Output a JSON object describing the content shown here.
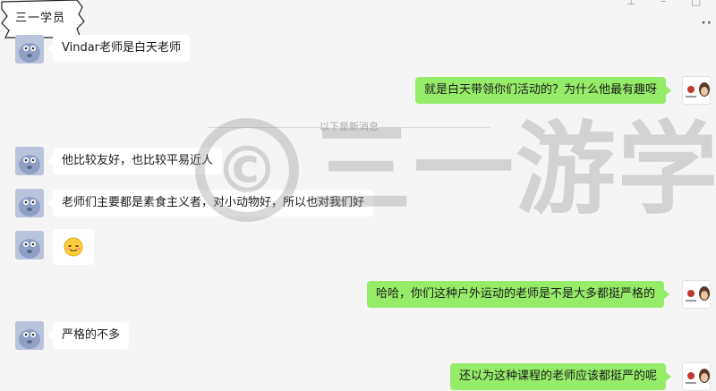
{
  "header": {
    "tag_label": "三一学员"
  },
  "divider_label": "以下是新消息",
  "watermark": {
    "symbol": "©",
    "text": "三一游学"
  },
  "messages": [
    {
      "side": "left",
      "text": "Vindar老师是白天老师"
    },
    {
      "side": "right",
      "text": "就是白天带领你们活动的？为什么他最有趣呀"
    },
    {
      "side": "left",
      "text": "他比较友好，也比较平易近人"
    },
    {
      "side": "left",
      "text": "老师们主要都是素食主义者，对小动物好，所以也对我们好"
    },
    {
      "side": "left",
      "text": "",
      "emoji": "smiling-face"
    },
    {
      "side": "right",
      "text": "哈哈，你们这种户外运动的老师是不是大多都挺严格的"
    },
    {
      "side": "left",
      "text": "严格的不多"
    },
    {
      "side": "right",
      "text": "还以为这种课程的老师应该都挺严的呢"
    }
  ]
}
